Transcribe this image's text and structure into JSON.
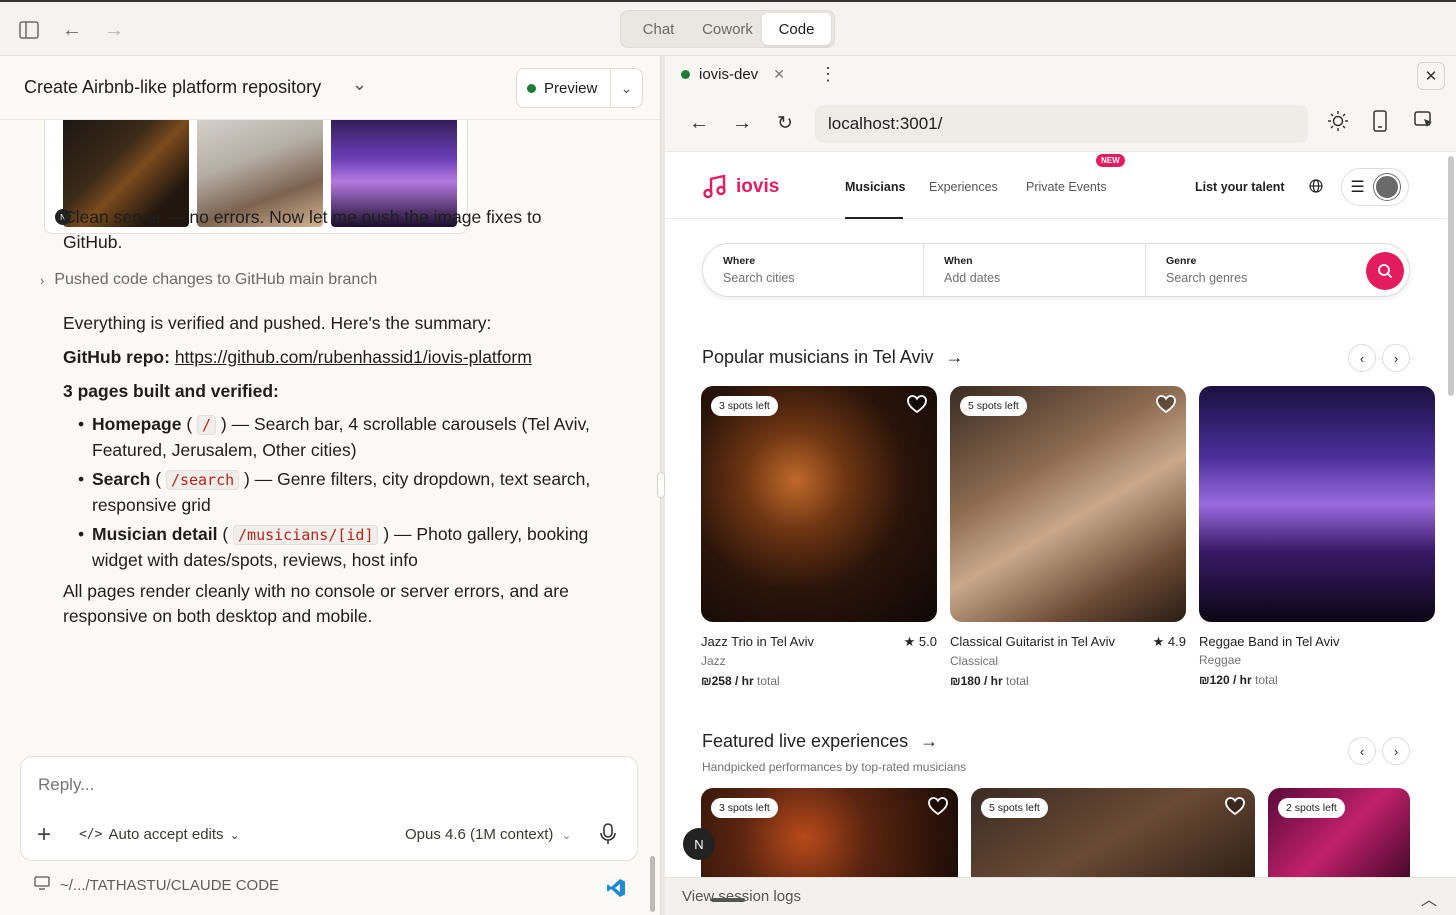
{
  "topbar": {
    "tabs": [
      {
        "label": "Chat",
        "active": false
      },
      {
        "label": "Cowork",
        "active": false
      },
      {
        "label": "Code",
        "active": true
      }
    ]
  },
  "conversation": {
    "title": "Create Airbnb-like platform repository",
    "preview_label": "Preview",
    "msg_clean": "Clean server — no errors. Now let me push the image fixes to GitHub.",
    "pushed_label": "Pushed code changes to GitHub main branch",
    "msg_verified": "Everything is verified and pushed. Here's the summary:",
    "repo_label": "GitHub repo:",
    "repo_url": "https://github.com/rubenhassid1/iovis-platform",
    "pages_heading": "3 pages built and verified:",
    "bullets": [
      {
        "name": "Homepage",
        "route": "/",
        "desc": "— Search bar, 4 scrollable carousels (Tel Aviv, Featured, Jerusalem, Other cities)"
      },
      {
        "name": "Search",
        "route": "/search",
        "desc": "— Genre filters, city dropdown, text search, responsive grid"
      },
      {
        "name": "Musician detail",
        "route": "/musicians/[id]",
        "desc": "— Photo gallery, booking widget with dates/spots, reviews, host info"
      }
    ],
    "msg_final": "All pages render cleanly with no console or server errors, and are responsive on both desktop and mobile.",
    "thumb_badge": "N"
  },
  "composer": {
    "placeholder": "Reply...",
    "accept_label": "Auto accept edits",
    "model_label": "Opus 4.6 (1M context)",
    "path": "~/.../TATHASTU/CLAUDE CODE"
  },
  "browser": {
    "tab_label": "iovis-dev",
    "url": "localhost:3001/",
    "session_logs": "View session logs",
    "n_badge": "N"
  },
  "site": {
    "brand": "iovis",
    "brand_color": "#e31c5f",
    "nav": [
      {
        "label": "Musicians",
        "active": true
      },
      {
        "label": "Experiences",
        "active": false
      },
      {
        "label": "Private Events",
        "active": false
      }
    ],
    "new_badge": "NEW",
    "list_talent": "List your talent",
    "search": [
      {
        "label": "Where",
        "placeholder": "Search cities"
      },
      {
        "label": "When",
        "placeholder": "Add dates"
      },
      {
        "label": "Genre",
        "placeholder": "Search genres"
      }
    ],
    "section1": {
      "title": "Popular musicians in Tel Aviv",
      "cards": [
        {
          "spots": "3 spots left",
          "title": "Jazz Trio in Tel Aviv",
          "rating": "5.0",
          "genre": "Jazz",
          "price": "₪258 / hr",
          "price_suffix": "total"
        },
        {
          "spots": "5 spots left",
          "title": "Classical Guitarist in Tel Aviv",
          "rating": "4.9",
          "genre": "Classical",
          "price": "₪180 / hr",
          "price_suffix": "total"
        },
        {
          "spots": "",
          "title": "Reggae Band in Tel Aviv",
          "rating": "",
          "genre": "Reggae",
          "price": "₪120 / hr",
          "price_suffix": "total"
        }
      ]
    },
    "section2": {
      "title": "Featured live experiences",
      "subtitle": "Handpicked performances by top-rated musicians",
      "cards": [
        {
          "spots": "3 spots left"
        },
        {
          "spots": "5 spots left"
        },
        {
          "spots": "2 spots left"
        }
      ]
    }
  }
}
